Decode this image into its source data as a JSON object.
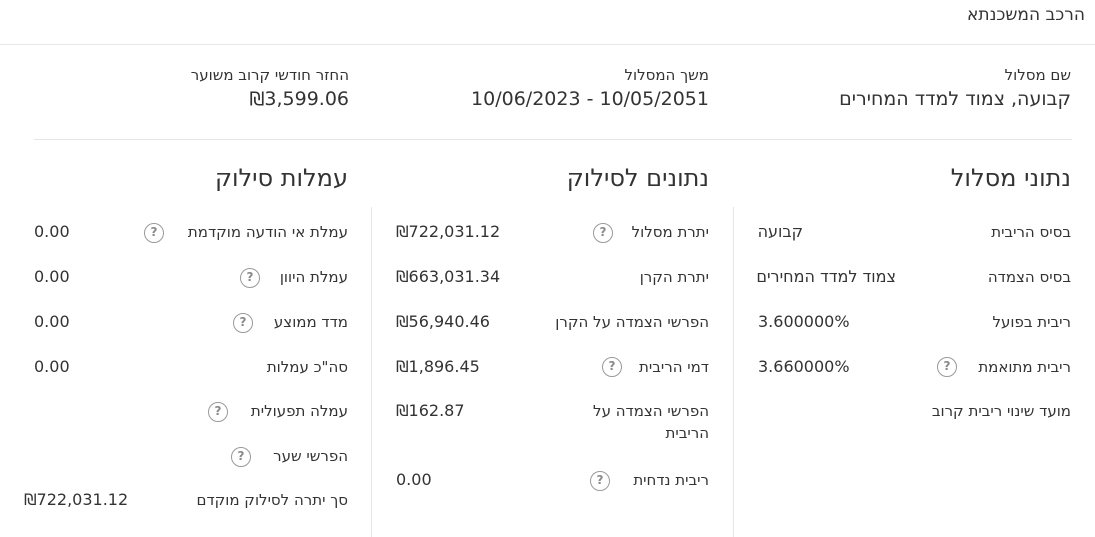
{
  "header": {
    "title": "הרכב המשכנתא"
  },
  "summary": {
    "track_name_label": "שם מסלול",
    "track_name_value": "קבועה, צמוד למדד המחירים",
    "track_period_label": "משך המסלול",
    "track_period_value": "10/06/2023 - 10/05/2051",
    "monthly_payment_label": "החזר חודשי קרוב משוער",
    "monthly_payment_value": "₪3,599.06"
  },
  "track_data": {
    "title": "נתוני מסלול",
    "rows": [
      {
        "label": "בסיס הריבית",
        "value": "קבועה",
        "help": false
      },
      {
        "label": "בסיס הצמדה",
        "value": "צמוד למדד המחירים",
        "help": false
      },
      {
        "label": "ריבית בפועל",
        "value": "3.600000%",
        "help": false
      },
      {
        "label": "ריבית מתואמת",
        "value": "3.660000%",
        "help": true
      },
      {
        "label": "מועד שינוי ריבית קרוב",
        "value": "",
        "help": false
      }
    ]
  },
  "payoff_data": {
    "title": "נתונים לסילוק",
    "rows": [
      {
        "label": "יתרת מסלול",
        "value": "₪722,031.12",
        "help": true
      },
      {
        "label": "יתרת הקרן",
        "value": "₪663,031.34",
        "help": false
      },
      {
        "label": "הפרשי הצמדה על הקרן",
        "value": "₪56,940.46",
        "help": false
      },
      {
        "label": "דמי הריבית",
        "value": "₪1,896.45",
        "help": true
      },
      {
        "label": "הפרשי הצמדה על הריבית",
        "value": "₪162.87",
        "help": false
      },
      {
        "label": "ריבית נדחית",
        "value": "0.00",
        "help": true
      }
    ]
  },
  "payoff_fees": {
    "title": "עמלות סילוק",
    "rows": [
      {
        "label": "עמלת אי הודעה מוקדמת",
        "value": "0.00",
        "help": true
      },
      {
        "label": "עמלת היוון",
        "value": "0.00",
        "help": true
      },
      {
        "label": "מדד ממוצע",
        "value": "0.00",
        "help": true
      },
      {
        "label": "סה\"כ עמלות",
        "value": "0.00",
        "help": false
      },
      {
        "label": "עמלה תפעולית",
        "value": "",
        "help": true
      },
      {
        "label": "הפרשי שער",
        "value": "",
        "help": true
      },
      {
        "label": "סך יתרה לסילוק מוקדם",
        "value": "₪722,031.12",
        "help": false
      }
    ]
  },
  "icons": {
    "help": "help-question-icon",
    "help_glyph": "?"
  }
}
